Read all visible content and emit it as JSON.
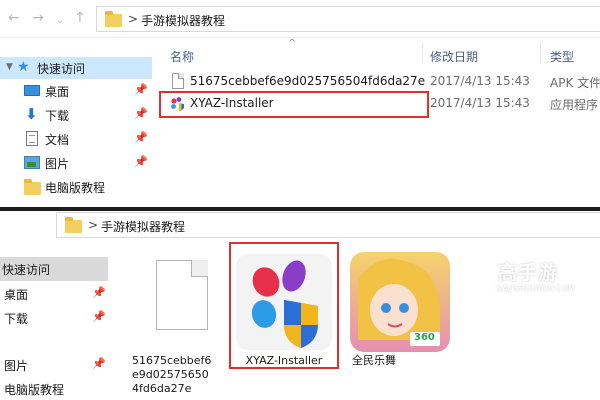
{
  "top_window": {
    "nav_back": "←",
    "nav_forward": "→",
    "breadcrumb_sep": ">",
    "breadcrumb_folder": "手游模拟器教程",
    "sidebar": {
      "items": [
        {
          "label": "快速访问"
        },
        {
          "label": "桌面",
          "pin": "📌"
        },
        {
          "label": "下载",
          "pin": "📌"
        },
        {
          "label": "文档",
          "pin": "📌"
        },
        {
          "label": "图片",
          "pin": "📌"
        },
        {
          "label": "电脑版教程"
        }
      ]
    },
    "columns": {
      "name": "名称",
      "date": "修改日期",
      "type": "类型"
    },
    "files": [
      {
        "name": "51675cebbef6e9d025756504fd6da27e",
        "date": "2017/4/13 15:43",
        "type": "APK 文件"
      },
      {
        "name": "XYAZ-Installer",
        "date": "2017/4/13 15:43",
        "type": "应用程序"
      }
    ]
  },
  "bottom_window": {
    "breadcrumb_sep": ">",
    "breadcrumb_folder": "手游模拟器教程",
    "sidebar": {
      "items": [
        {
          "label": "快速访问"
        },
        {
          "label": "桌面",
          "pin": "📌"
        },
        {
          "label": "下载",
          "pin": "📌"
        },
        {
          "label": "图片",
          "pin": "📌"
        },
        {
          "label": "电脑版教程"
        }
      ]
    },
    "tiles": [
      {
        "caption": "51675cebbef6e9d025756504fd6da27e"
      },
      {
        "caption": "XYAZ-Installer"
      },
      {
        "caption": "全民乐舞",
        "badge": "360"
      }
    ]
  },
  "watermark": {
    "main": "高手游",
    "sub": "GAOSHOUYOU.COM"
  },
  "colors": {
    "highlight": "#e02f2f",
    "selected_nav": "#cce8ff",
    "column_header": "#4d6082"
  }
}
